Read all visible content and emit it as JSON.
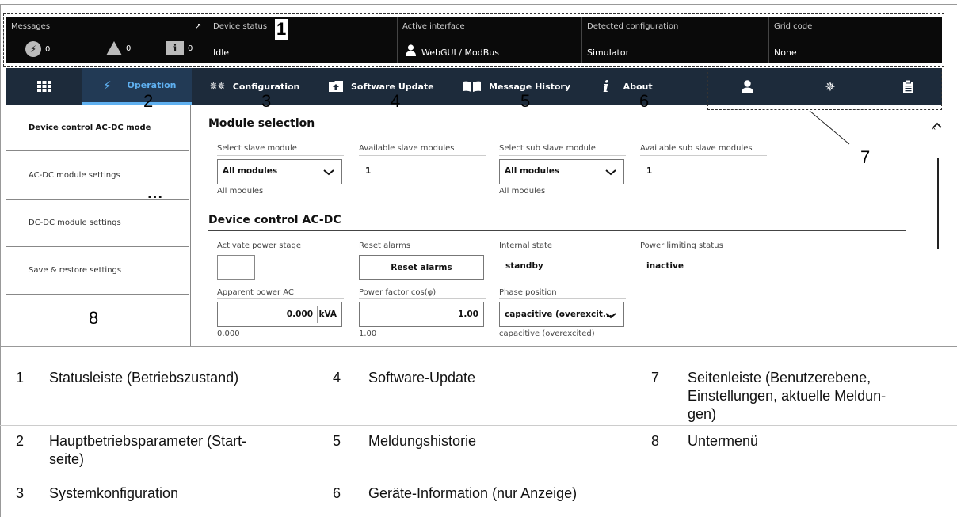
{
  "statusbar": {
    "messages_label": "Messages",
    "messages": [
      {
        "icon": "lightning-circle-icon",
        "count": "0"
      },
      {
        "icon": "warning-triangle-icon",
        "count": "0"
      },
      {
        "icon": "info-icon",
        "glyph": "i",
        "count": "0"
      }
    ],
    "device_status_label": "Device status",
    "device_status_value": "Idle",
    "active_interface_label": "Active interface",
    "active_interface_value": "WebGUI / ModBus",
    "detected_configuration_label": "Detected configuration",
    "detected_configuration_value": "Simulator",
    "grid_code_label": "Grid code",
    "grid_code_value": "None"
  },
  "nav": {
    "items": [
      {
        "label": "",
        "icon": "grid-icon"
      },
      {
        "label": "Operation",
        "icon": "lightning-icon"
      },
      {
        "label": "Configuration",
        "icon": "gears-icon"
      },
      {
        "label": "Software Update",
        "icon": "folder-upload-icon"
      },
      {
        "label": "Message History",
        "icon": "book-icon"
      },
      {
        "label": "About",
        "icon": "info-italic-icon"
      }
    ],
    "sidebar_icons": [
      "user-icon",
      "gear-icon",
      "clipboard-icon"
    ]
  },
  "markers": [
    "1",
    "2",
    "3",
    "4",
    "5",
    "6",
    "7",
    "8"
  ],
  "submenu": {
    "items": [
      "Device control AC-DC mode",
      "AC-DC module settings",
      "DC-DC module settings",
      "Save & restore settings"
    ],
    "more": "..."
  },
  "module_selection": {
    "title": "Module selection",
    "select_slave_label": "Select slave module",
    "select_slave_value": "All modules",
    "select_slave_sub": "All modules",
    "available_slave_label": "Available slave modules",
    "available_slave_value": "1",
    "select_sub_slave_label": "Select sub slave module",
    "select_sub_slave_value": "All modules",
    "select_sub_slave_sub": "All modules",
    "available_sub_slave_label": "Available sub slave modules",
    "available_sub_slave_value": "1"
  },
  "device_control": {
    "title": "Device control AC-DC",
    "activate_label": "Activate power stage",
    "reset_label": "Reset alarms",
    "reset_button": "Reset alarms",
    "internal_state_label": "Internal state",
    "internal_state_value": "standby",
    "power_limiting_label": "Power limiting status",
    "power_limiting_value": "inactive",
    "apparent_power_label": "Apparent power AC",
    "apparent_power_value": "0.000",
    "apparent_power_unit": "kVA",
    "apparent_power_sub": "0.000",
    "power_factor_label": "Power factor cos(φ)",
    "power_factor_value": "1.00",
    "power_factor_sub": "1.00",
    "phase_position_label": "Phase position",
    "phase_position_value": "capacitive (overexcit...",
    "phase_position_sub": "capacitive (overexcited)"
  },
  "legend": [
    {
      "num": "1",
      "text": "Statusleiste (Betriebszustand)"
    },
    {
      "num": "4",
      "text": "Software-Update"
    },
    {
      "num": "7",
      "text": "Seitenleiste (Benutzerebene, Einstellungen, aktuelle Meldun-gen)",
      "lines": [
        "Seitenleiste (Benutzerebene,",
        "Einstellungen, aktuelle Meldun-",
        "gen)"
      ]
    },
    {
      "num": "2",
      "text": "Hauptbetriebsparameter (Start-seite)",
      "lines": [
        "Hauptbetriebsparameter (Start-",
        "seite)"
      ]
    },
    {
      "num": "5",
      "text": "Meldungshistorie"
    },
    {
      "num": "8",
      "text": "Untermenü"
    },
    {
      "num": "3",
      "text": "Systemkonfiguration"
    },
    {
      "num": "6",
      "text": "Geräte-Information (nur Anzeige)"
    }
  ]
}
